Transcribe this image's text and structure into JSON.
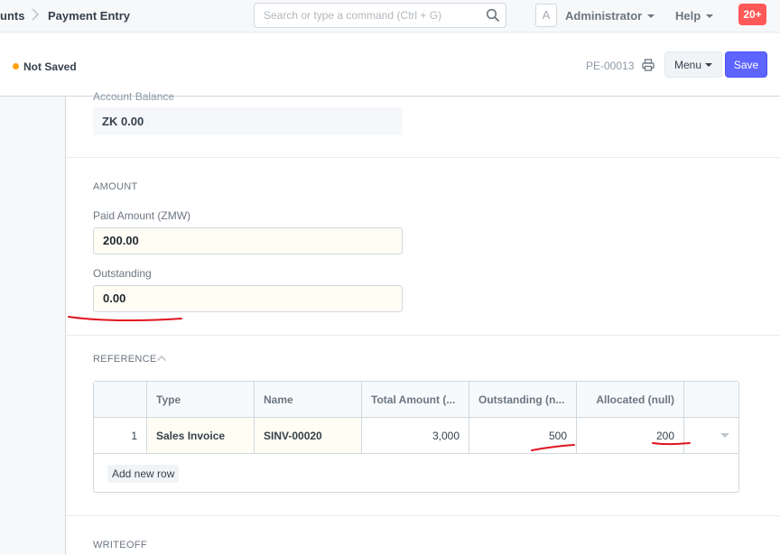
{
  "navbar": {
    "breadcrumb_parent": "unts",
    "breadcrumb_current": "Payment Entry",
    "search_placeholder": "Search or type a command (Ctrl + G)",
    "avatar_letter": "A",
    "user_label": "Administrator",
    "help_label": "Help",
    "notification_count": "20+"
  },
  "page_head": {
    "status": "Not Saved",
    "status_color": "#ffa00a",
    "doc_id": "PE-00013",
    "menu_label": "Menu",
    "save_label": "Save",
    "save_color": "#5e64ff"
  },
  "form": {
    "account_balance_label": "Account Balance",
    "account_balance_value": "ZK 0.00",
    "amount_section": "AMOUNT",
    "paid_amount_label": "Paid Amount (ZMW)",
    "paid_amount_value": "200.00",
    "outstanding_label": "Outstanding",
    "outstanding_value": "0.00",
    "reference_section": "REFERENCE",
    "writeoff_section": "WRITEOFF"
  },
  "reference_table": {
    "columns": [
      "Type",
      "Name",
      "Total Amount (...",
      "Outstanding (n...",
      "Allocated (null)"
    ],
    "rows": [
      {
        "idx": "1",
        "type": "Sales Invoice",
        "name": "SINV-00020",
        "total": "3,000",
        "outstanding": "500",
        "allocated": "200"
      }
    ],
    "add_row_label": "Add new row"
  },
  "annotation_color": "#e0141e"
}
